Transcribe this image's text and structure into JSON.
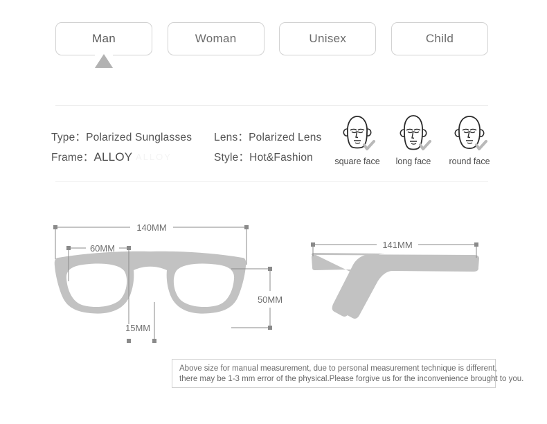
{
  "tabs": [
    {
      "label": "Man",
      "active": true
    },
    {
      "label": "Woman",
      "active": false
    },
    {
      "label": "Unisex",
      "active": false
    },
    {
      "label": "Child",
      "active": false
    }
  ],
  "spec": {
    "type_label": "Type：",
    "type_value": "Polarized Sunglasses",
    "lens_label": "Lens：",
    "lens_value": "Polarized Lens",
    "frame_label": "Frame：",
    "frame_value": "ALLOY",
    "style_label": "Style：",
    "style_value": "Hot&Fashion",
    "ghost_text": "ALLOY"
  },
  "faces": [
    {
      "label": "square face"
    },
    {
      "label": "long face"
    },
    {
      "label": "round face"
    }
  ],
  "dimensions": {
    "front_width": "140MM",
    "lens_span": "60MM",
    "bridge": "15MM",
    "lens_height": "50MM",
    "temple_length": "141MM"
  },
  "disclaimer": {
    "line1": "Above size for manual measurement, due to personal measurement technique is different,",
    "line2": "there may be 1-3 mm error of the physical.Please forgive us for the inconvenience brought to you."
  },
  "colors": {
    "frame_gray": "#c2c2c2",
    "dim_line": "#7a7a7a",
    "tab_border": "#d2d2d2",
    "marker_gray": "#b2b2b2",
    "divider": "#ececec"
  }
}
